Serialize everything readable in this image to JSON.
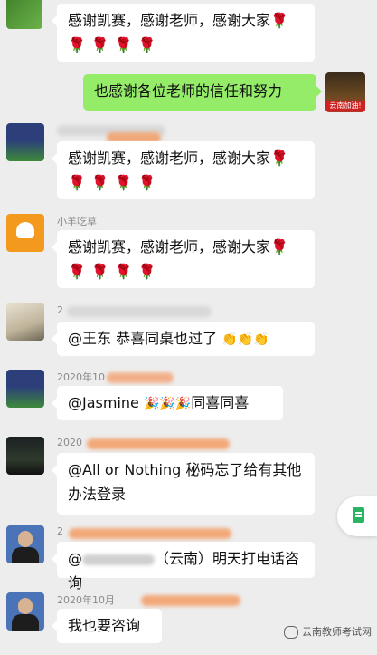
{
  "messages": [
    {
      "text": "感谢凯赛，感谢老师，感谢大家🌹",
      "roses": "🌹🌹🌹🌹"
    },
    {
      "text": "也感谢各位老师的信任和努力",
      "avatar_caption": "云南加油!"
    },
    {
      "text": "感谢凯赛，感谢老师，感谢大家🌹",
      "roses": "🌹🌹🌹🌹"
    },
    {
      "name": "小羊吃草",
      "text": "感谢凯赛，感谢老师，感谢大家🌹",
      "roses": "🌹🌹🌹🌹"
    },
    {
      "name": "2",
      "text": "@王东  恭喜同桌也过了",
      "emoji": "👏👏👏"
    },
    {
      "name": "2020年10",
      "text_a": "@Jasmine ",
      "emoji": "🎉🎉🎉",
      "text_b": "同喜同喜"
    },
    {
      "name": "2020",
      "text": "@All or Nothing 秘码忘了给有其他办法登录"
    },
    {
      "name": "2",
      "text": "（云南）明天打电话咨询",
      "prefix": "@"
    },
    {
      "name": "2020年10月",
      "text": "我也要咨询"
    }
  ],
  "watermark": "云南教师考试网",
  "colors": {
    "mine": "#95ec69",
    "background": "#ededed"
  }
}
